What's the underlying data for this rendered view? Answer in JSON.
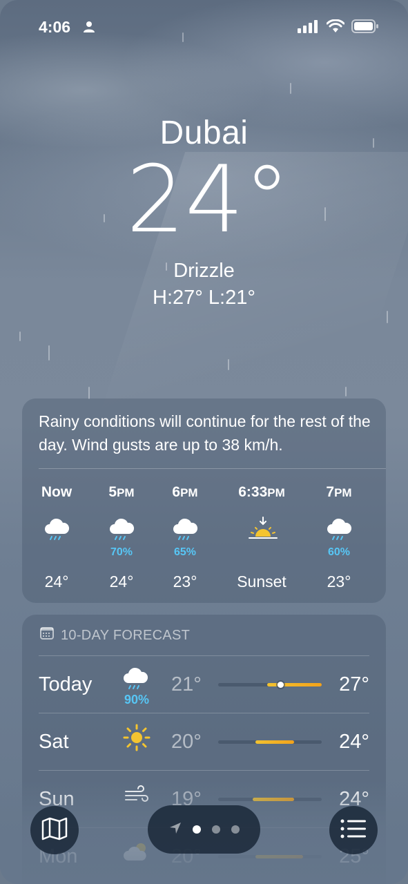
{
  "status_bar": {
    "time": "4:06"
  },
  "location": {
    "city": "Dubai",
    "temperature": "24°",
    "condition": "Drizzle",
    "high_low": "H:27°  L:21°"
  },
  "summary_card": {
    "text": "Rainy conditions will continue for the rest of the day. Wind gusts are up to 38 km/h.",
    "hourly": [
      {
        "label": "Now",
        "icon": "rain-cloud-icon",
        "precip": "",
        "temp": "24°"
      },
      {
        "label": "5",
        "label_suffix": "PM",
        "icon": "rain-cloud-icon",
        "precip": "70%",
        "temp": "24°"
      },
      {
        "label": "6",
        "label_suffix": "PM",
        "icon": "rain-cloud-icon",
        "precip": "65%",
        "temp": "23°"
      },
      {
        "label": "6:33",
        "label_suffix": "PM",
        "icon": "sunset-icon",
        "precip": "",
        "temp": "Sunset"
      },
      {
        "label": "7",
        "label_suffix": "PM",
        "icon": "rain-cloud-icon",
        "precip": "60%",
        "temp": "23°"
      }
    ]
  },
  "forecast": {
    "header": "10-DAY FORECAST",
    "days": [
      {
        "day": "Today",
        "icon": "rain-cloud-icon",
        "precip": "90%",
        "low": "21°",
        "high": "27°",
        "range_start": 0.47,
        "range_end": 1.0,
        "current": 0.6
      },
      {
        "day": "Sat",
        "icon": "sun-icon",
        "precip": "",
        "low": "20°",
        "high": "24°",
        "range_start": 0.36,
        "range_end": 0.73
      },
      {
        "day": "Sun",
        "icon": "wind-icon",
        "precip": "",
        "low": "19°",
        "high": "24°",
        "range_start": 0.33,
        "range_end": 0.73
      },
      {
        "day": "Mon",
        "icon": "partly-cloudy-icon",
        "precip": "",
        "low": "20°",
        "high": "25°",
        "range_start": 0.36,
        "range_end": 0.82
      }
    ]
  },
  "colors": {
    "precip": "#57c6f5",
    "temp_bar": "#f2b21f"
  }
}
